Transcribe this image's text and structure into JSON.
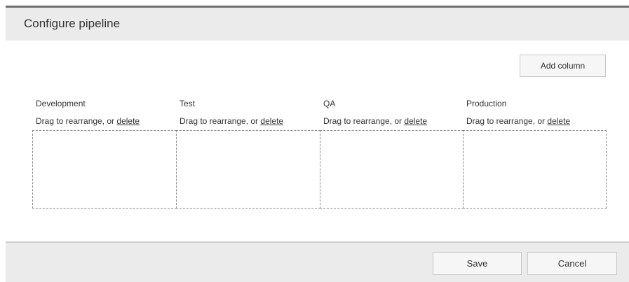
{
  "dialog": {
    "title": "Configure pipeline"
  },
  "toolbar": {
    "add_column_label": "Add column"
  },
  "columns": [
    {
      "title": "Development",
      "hint_prefix": "Drag to rearrange, or ",
      "delete_label": "delete"
    },
    {
      "title": "Test",
      "hint_prefix": "Drag to rearrange, or ",
      "delete_label": "delete"
    },
    {
      "title": "QA",
      "hint_prefix": "Drag to rearrange, or ",
      "delete_label": "delete"
    },
    {
      "title": "Production",
      "hint_prefix": "Drag to rearrange, or ",
      "delete_label": "delete"
    }
  ],
  "footer": {
    "save_label": "Save",
    "cancel_label": "Cancel"
  },
  "colors": {
    "header_bg": "#ebebeb",
    "header_border": "#6f6f6f",
    "footer_bg": "#ebebeb",
    "button_bg": "#f6f6f6",
    "dropzone_border": "#8a8a8a"
  }
}
